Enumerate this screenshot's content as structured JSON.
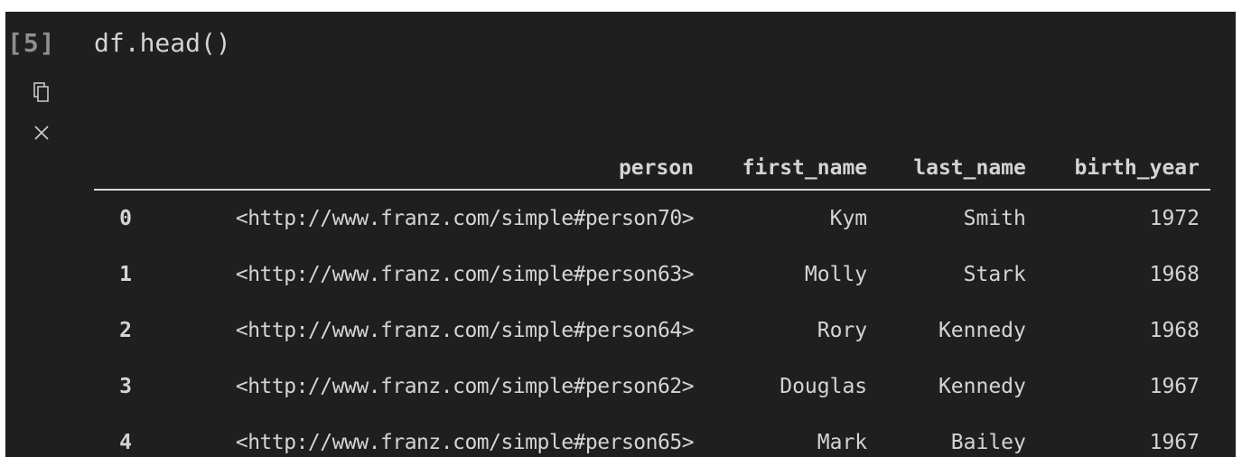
{
  "cell": {
    "execution_count": "[5]",
    "code": "df.head()",
    "toolbar": {
      "copy_icon": "copy-icon",
      "clear_icon": "close-icon",
      "clear_glyph": "×"
    }
  },
  "table": {
    "columns": [
      "person",
      "first_name",
      "last_name",
      "birth_year"
    ],
    "rows": [
      {
        "index": "0",
        "person": "<http://www.franz.com/simple#person70>",
        "first_name": "Kym",
        "last_name": "Smith",
        "birth_year": "1972"
      },
      {
        "index": "1",
        "person": "<http://www.franz.com/simple#person63>",
        "first_name": "Molly",
        "last_name": "Stark",
        "birth_year": "1968"
      },
      {
        "index": "2",
        "person": "<http://www.franz.com/simple#person64>",
        "first_name": "Rory",
        "last_name": "Kennedy",
        "birth_year": "1968"
      },
      {
        "index": "3",
        "person": "<http://www.franz.com/simple#person62>",
        "first_name": "Douglas",
        "last_name": "Kennedy",
        "birth_year": "1967"
      },
      {
        "index": "4",
        "person": "<http://www.franz.com/simple#person65>",
        "first_name": "Mark",
        "last_name": "Bailey",
        "birth_year": "1967"
      }
    ]
  },
  "colors": {
    "background": "#1f1f1f",
    "text": "#d4d4d4",
    "muted": "#8f8f8f",
    "rule": "#d9d9d9"
  }
}
